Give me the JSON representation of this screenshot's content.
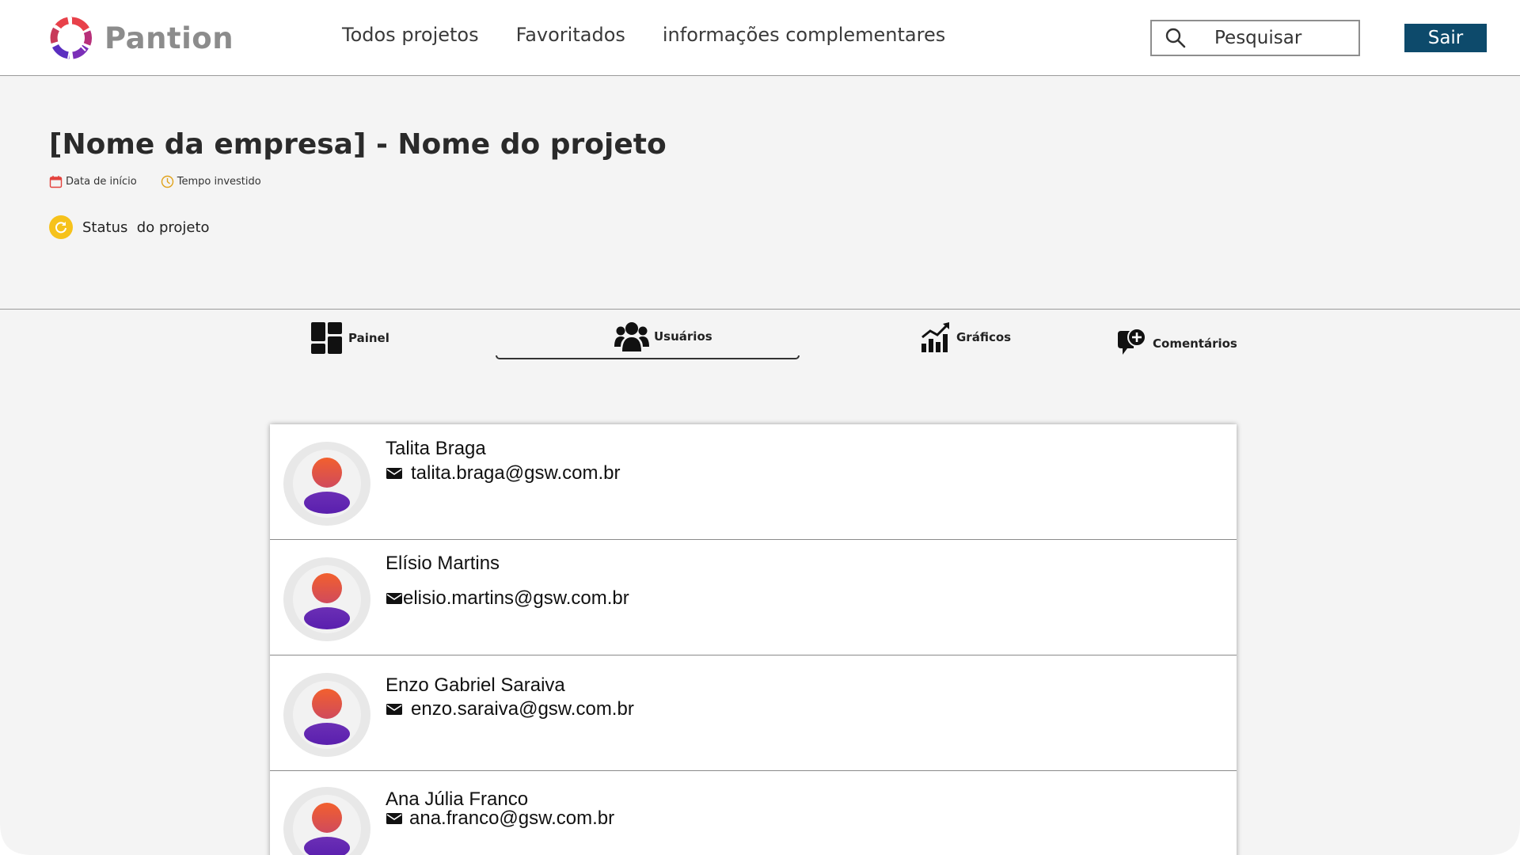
{
  "app": {
    "name": "Pantion"
  },
  "nav": {
    "items": [
      {
        "label": "Todos projetos"
      },
      {
        "label": "Favoritados"
      },
      {
        "label": "informações complementares"
      }
    ]
  },
  "search": {
    "placeholder": "Pesquisar",
    "icon": "search-icon"
  },
  "header": {
    "exit_label": "Sair",
    "exit_color": "#0d4a6b"
  },
  "project": {
    "title": "[Nome da empresa] - Nome do projeto",
    "start_date_label": "Data de início",
    "time_invested_label": "Tempo investido",
    "status_label": "Status  do projeto",
    "status_color": "#f6c21b"
  },
  "tabs": {
    "items": [
      {
        "label": "Painel",
        "icon": "dashboard-icon"
      },
      {
        "label": "Usuários",
        "icon": "users-icon",
        "active": true
      },
      {
        "label": "Gráficos",
        "icon": "chart-icon"
      },
      {
        "label": "Comentários",
        "icon": "comment-add-icon"
      }
    ]
  },
  "users": [
    {
      "name": "Talita Braga",
      "email": "talita.braga@gsw.com.br"
    },
    {
      "name": "Elísio Martins",
      "email": "elisio.martins@gsw.com.br"
    },
    {
      "name": "Enzo Gabriel Saraiva",
      "email": "enzo.saraiva@gsw.com.br"
    },
    {
      "name": "Ana Júlia Franco",
      "email": "ana.franco@gsw.com.br"
    }
  ]
}
